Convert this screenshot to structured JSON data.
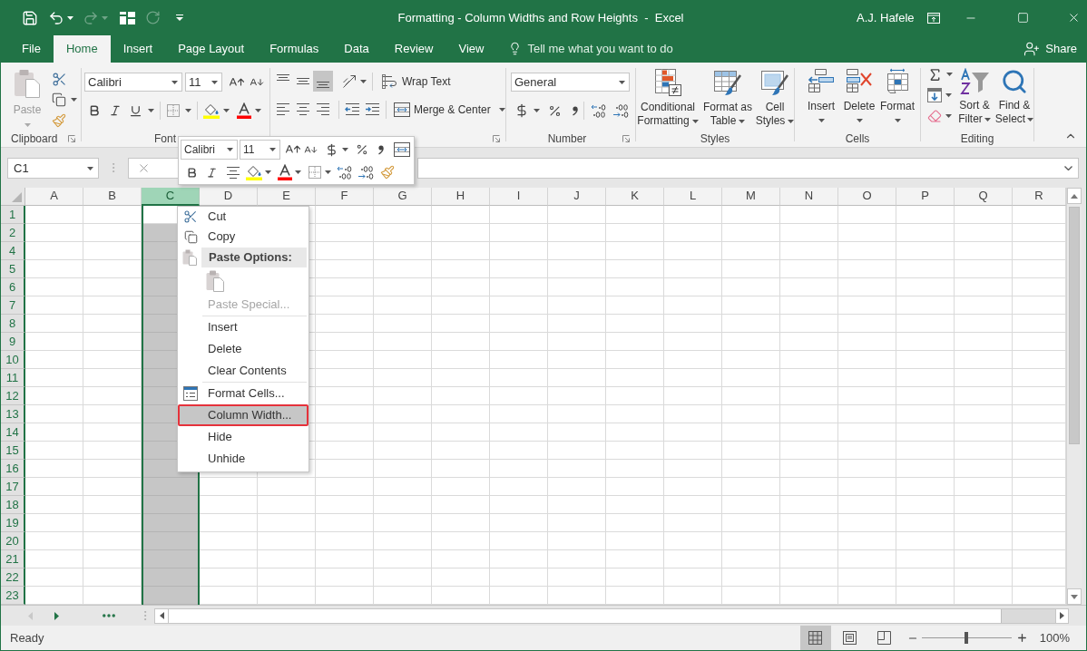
{
  "window": {
    "title": "Formatting - Column Widths and Row Heights  -  Excel",
    "user": "A.J. Hafele"
  },
  "quick_access": [
    {
      "disabled": false
    },
    {
      "disabled": false
    },
    {
      "disabled": true
    },
    {
      "disabled": false
    },
    {
      "disabled": true
    },
    {
      "disabled": false
    }
  ],
  "tabs": [
    {
      "label": "File",
      "selected": false
    },
    {
      "label": "Home",
      "selected": true
    },
    {
      "label": "Insert",
      "selected": false
    },
    {
      "label": "Page Layout",
      "selected": false
    },
    {
      "label": "Formulas",
      "selected": false
    },
    {
      "label": "Data",
      "selected": false
    },
    {
      "label": "Review",
      "selected": false
    },
    {
      "label": "View",
      "selected": false
    }
  ],
  "tell_me": {
    "placeholder": "Tell me what you want to do"
  },
  "share": "Share",
  "ribbon": {
    "clipboard": {
      "paste": {
        "label": "Paste",
        "disabled": true
      },
      "label": "Clipboard"
    },
    "font": {
      "font_name": "Calibri",
      "font_size": "11",
      "label": "Font"
    },
    "alignment": {
      "vertical_align": [
        {
          "selected": false
        },
        {
          "selected": false
        },
        {
          "selected": true
        }
      ],
      "horizontal_align": [
        {
          "selected": false
        },
        {
          "selected": false
        },
        {
          "selected": false
        }
      ],
      "wrap_text": "Wrap Text",
      "merge": "Merge & Center"
    },
    "number": {
      "format": "General",
      "label": "Number"
    },
    "styles": {
      "buttons": [
        "Conditional Formatting",
        "Format as Table",
        "Cell Styles"
      ],
      "label": "Styles"
    },
    "cells": {
      "buttons": [
        "Insert",
        "Delete",
        "Format"
      ],
      "label": "Cells"
    },
    "editing": {
      "buttons": [
        "Sort & Filter",
        "Find & Select"
      ],
      "label": "Editing"
    }
  },
  "formula_bar": {
    "name_box": "C1"
  },
  "mini_toolbar": {
    "font_name": "Calibri",
    "font_size": "11"
  },
  "sheet": {
    "columns": [
      {
        "label": "A",
        "selected": false
      },
      {
        "label": "B",
        "selected": false
      },
      {
        "label": "C",
        "selected": true
      },
      {
        "label": "D",
        "selected": false
      },
      {
        "label": "E",
        "selected": false
      },
      {
        "label": "F",
        "selected": false
      },
      {
        "label": "G",
        "selected": false
      },
      {
        "label": "H",
        "selected": false
      },
      {
        "label": "I",
        "selected": false
      },
      {
        "label": "J",
        "selected": false
      },
      {
        "label": "K",
        "selected": false
      },
      {
        "label": "L",
        "selected": false
      },
      {
        "label": "M",
        "selected": false
      },
      {
        "label": "N",
        "selected": false
      },
      {
        "label": "O",
        "selected": false
      },
      {
        "label": "P",
        "selected": false
      },
      {
        "label": "Q",
        "selected": false
      },
      {
        "label": "R",
        "selected": false
      }
    ],
    "rows": [
      {
        "label": "1",
        "active": true
      },
      {
        "label": "2",
        "active": false
      },
      {
        "label": "4",
        "active": false
      },
      {
        "label": "5",
        "active": false
      },
      {
        "label": "6",
        "active": false
      },
      {
        "label": "7",
        "active": false
      },
      {
        "label": "8",
        "active": false
      },
      {
        "label": "9",
        "active": false
      },
      {
        "label": "10",
        "active": false
      },
      {
        "label": "11",
        "active": false
      },
      {
        "label": "12",
        "active": false
      },
      {
        "label": "13",
        "active": false
      },
      {
        "label": "14",
        "active": false
      },
      {
        "label": "15",
        "active": false
      },
      {
        "label": "16",
        "active": false
      },
      {
        "label": "17",
        "active": false
      },
      {
        "label": "18",
        "active": false
      },
      {
        "label": "19",
        "active": false
      },
      {
        "label": "20",
        "active": false
      },
      {
        "label": "21",
        "active": false
      },
      {
        "label": "22",
        "active": false
      },
      {
        "label": "23",
        "active": false
      }
    ]
  },
  "context_menu": [
    {
      "kind": "command",
      "label": "Cut",
      "disabled": false,
      "selected": false,
      "outlined": false
    },
    {
      "kind": "command",
      "label": "Copy",
      "disabled": false,
      "selected": false,
      "outlined": false
    },
    {
      "kind": "header",
      "label": "Paste Options:"
    },
    {
      "kind": "paste_icons"
    },
    {
      "kind": "command",
      "label": "Paste Special...",
      "disabled": true,
      "selected": false,
      "outlined": false
    },
    {
      "kind": "separator"
    },
    {
      "kind": "command",
      "label": "Insert",
      "disabled": false,
      "selected": false,
      "outlined": false
    },
    {
      "kind": "command",
      "label": "Delete",
      "disabled": false,
      "selected": false,
      "outlined": false
    },
    {
      "kind": "command",
      "label": "Clear Contents",
      "disabled": false,
      "selected": false,
      "outlined": false
    },
    {
      "kind": "separator"
    },
    {
      "kind": "command",
      "label": "Format Cells...",
      "disabled": false,
      "selected": false,
      "outlined": false
    },
    {
      "kind": "command",
      "label": "Column Width...",
      "disabled": false,
      "selected": true,
      "outlined": true
    },
    {
      "kind": "command",
      "label": "Hide",
      "disabled": false,
      "selected": false,
      "outlined": false
    },
    {
      "kind": "command",
      "label": "Unhide",
      "disabled": false,
      "selected": false,
      "outlined": false
    }
  ],
  "sheet_nav": [
    {
      "disabled": true
    },
    {
      "disabled": false
    }
  ],
  "status_bar": {
    "status": "Ready",
    "views": [
      {
        "selected": true
      },
      {
        "selected": false
      },
      {
        "selected": false
      }
    ],
    "zoom_slider": {
      "level": 0.5
    },
    "zoom": "100%"
  }
}
